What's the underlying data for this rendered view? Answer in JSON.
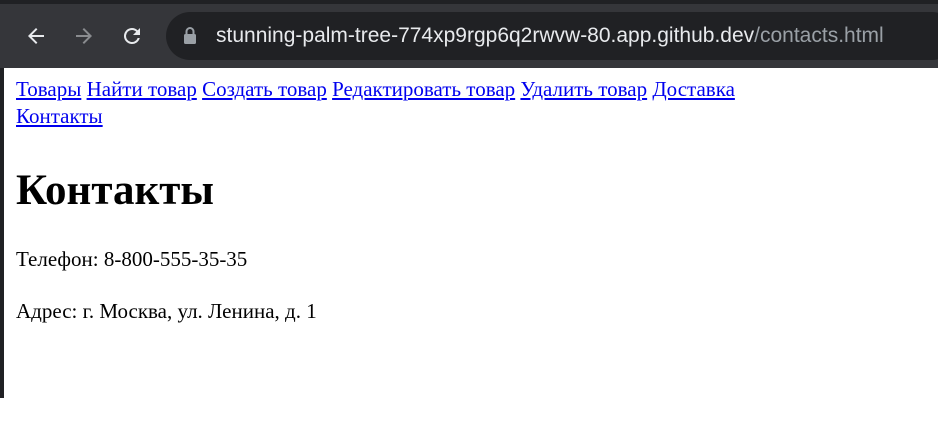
{
  "browser": {
    "back_icon": "arrow-left-icon",
    "forward_icon": "arrow-right-icon",
    "reload_icon": "reload-icon",
    "lock_icon": "lock-icon",
    "url_host": "stunning-palm-tree-774xp9rgp6q2rwvw-80.app.github.dev",
    "url_path": "/contacts.html",
    "colors": {
      "toolbar": "#35363a",
      "omnibox": "#202124",
      "url_host": "#e8eaed",
      "url_path": "#9aa0a6"
    }
  },
  "nav": {
    "links": [
      "Товары",
      "Найти товар",
      "Создать товар",
      "Редактировать товар",
      "Удалить товар",
      "Доставка",
      "Контакты"
    ],
    "link_color": "#0000ee"
  },
  "main": {
    "heading": "Контакты",
    "phone": "Телефон: 8-800-555-35-35",
    "address": "Адрес: г. Москва, ул. Ленина, д. 1"
  }
}
